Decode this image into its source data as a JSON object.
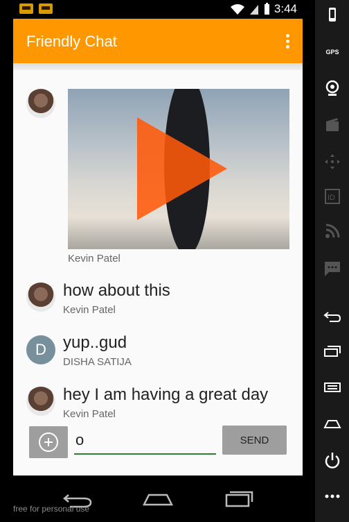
{
  "status_bar": {
    "time": "3:44"
  },
  "app_bar": {
    "title": "Friendly Chat"
  },
  "messages": [
    {
      "type": "video",
      "sender": "Kevin Patel",
      "avatar": "photo"
    },
    {
      "type": "text",
      "text": "how about this",
      "sender": "Kevin Patel",
      "avatar": "photo"
    },
    {
      "type": "text",
      "text": "yup..gud",
      "sender": "DISHA SATIJA",
      "avatar_letter": "D"
    },
    {
      "type": "text",
      "text": "hey I am having a great day",
      "sender": "Kevin Patel",
      "avatar": "photo"
    }
  ],
  "input": {
    "value": "o",
    "send_label": "SEND"
  },
  "watermark": "free for personal use",
  "side_panel": {
    "gps_label": "GPS"
  },
  "colors": {
    "app_bar": "#ff9800",
    "input_underline": "#2e7d32",
    "play": "#ff5a0a"
  }
}
